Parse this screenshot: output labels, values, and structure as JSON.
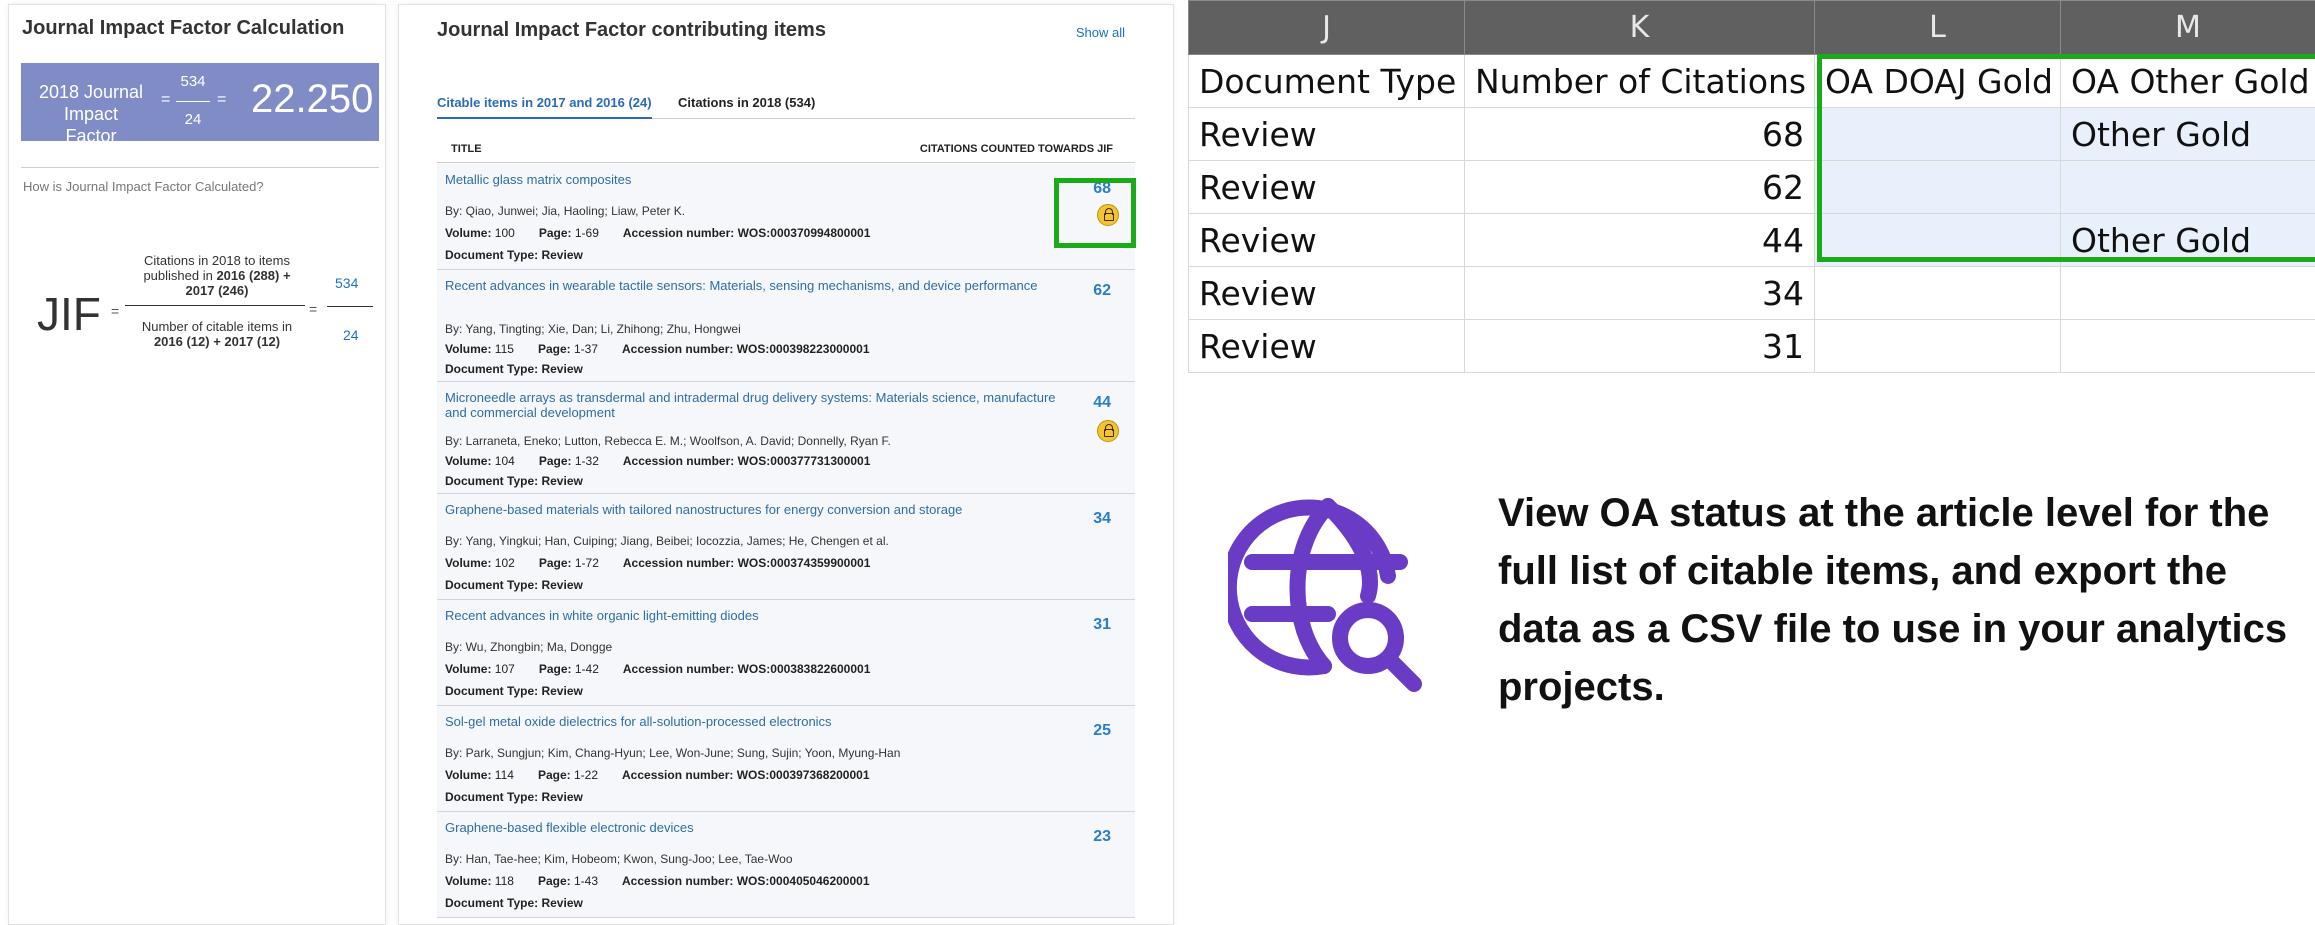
{
  "jif_panel": {
    "title": "Journal Impact Factor Calculation",
    "year_label": "2018 Journal Impact Factor",
    "numerator": "534",
    "denominator": "24",
    "value": "22.250",
    "how_link": "How is Journal Impact Factor Calculated?",
    "formula": {
      "symbol": "JIF",
      "numerator_text": "Citations in 2018 to items published in",
      "numerator_bold": "2016 (288) + 2017 (246)",
      "denominator_text": "Number of citable items in",
      "denominator_bold": "2016 (12) + 2017 (12)",
      "result_numerator": "534",
      "result_denominator": "24"
    }
  },
  "items_panel": {
    "title": "Journal Impact Factor contributing items",
    "show_all": "Show all",
    "tabs": [
      "Citable items in 2017 and 2016 (24)",
      "Citations in 2018 (534)"
    ],
    "col_title": "TITLE",
    "col_citations": "CITATIONS COUNTED TOWARDS JIF",
    "labels": {
      "volume": "Volume:",
      "page": "Page:",
      "accession": "Accession number:",
      "doc_type": "Document Type:"
    },
    "rows": [
      {
        "title": "Metallic glass matrix composites",
        "authors": "By: Qiao, Junwei; Jia, Haoling; Liaw, Peter K.",
        "volume": "100",
        "page": "1-69",
        "accession": "WOS:000370994800001",
        "doc_type": "Review",
        "citations": "68",
        "oa": true
      },
      {
        "title": "Recent advances in wearable tactile sensors: Materials, sensing mechanisms, and device performance",
        "authors": "By: Yang, Tingting; Xie, Dan; Li, Zhihong; Zhu, Hongwei",
        "volume": "115",
        "page": "1-37",
        "accession": "WOS:000398223000001",
        "doc_type": "Review",
        "citations": "62",
        "oa": false
      },
      {
        "title": "Microneedle arrays as transdermal and intradermal drug delivery systems: Materials science, manufacture and commercial development",
        "authors": "By: Larraneta, Eneko; Lutton, Rebecca E. M.; Woolfson, A. David; Donnelly, Ryan F.",
        "volume": "104",
        "page": "1-32",
        "accession": "WOS:000377731300001",
        "doc_type": "Review",
        "citations": "44",
        "oa": true
      },
      {
        "title": "Graphene-based materials with tailored nanostructures for energy conversion and storage",
        "authors": "By: Yang, Yingkui; Han, Cuiping; Jiang, Beibei; Iocozzia, James; He, Chengen et al.",
        "volume": "102",
        "page": "1-72",
        "accession": "WOS:000374359900001",
        "doc_type": "Review",
        "citations": "34",
        "oa": false
      },
      {
        "title": "Recent advances in white organic light-emitting diodes",
        "authors": "By: Wu, Zhongbin; Ma, Dongge",
        "volume": "107",
        "page": "1-42",
        "accession": "WOS:000383822600001",
        "doc_type": "Review",
        "citations": "31",
        "oa": false
      },
      {
        "title": "Sol-gel metal oxide dielectrics for all-solution-processed electronics",
        "authors": "By: Park, Sungjun; Kim, Chang-Hyun; Lee, Won-June; Sung, Sujin; Yoon, Myung-Han",
        "volume": "114",
        "page": "1-22",
        "accession": "WOS:000397368200001",
        "doc_type": "Review",
        "citations": "25",
        "oa": false
      },
      {
        "title": "Graphene-based flexible electronic devices",
        "authors": "By: Han, Tae-hee; Kim, Hobeom; Kwon, Sung-Joo; Lee, Tae-Woo",
        "volume": "118",
        "page": "1-43",
        "accession": "WOS:000405046200001",
        "doc_type": "Review",
        "citations": "23",
        "oa": false
      }
    ]
  },
  "spreadsheet": {
    "columns": [
      "J",
      "K",
      "L",
      "M"
    ],
    "headers": [
      "Document Type",
      "Number of Citations",
      "OA DOAJ Gold",
      "OA Other Gold"
    ],
    "rows": [
      [
        "Review",
        "68",
        "",
        "Other Gold"
      ],
      [
        "Review",
        "62",
        "",
        ""
      ],
      [
        "Review",
        "44",
        "",
        "Other Gold"
      ],
      [
        "Review",
        "34",
        "",
        ""
      ],
      [
        "Review",
        "31",
        "",
        ""
      ]
    ]
  },
  "promo": {
    "icon": "globe-search-icon",
    "icon_color": "#6a3bc4",
    "text": "View OA status at the article level for the full list of citable items, and export the data as a CSV file to use in your analytics projects."
  },
  "colors": {
    "highlight": "#1aaa1a",
    "jif_box": "#7f8cc6",
    "link": "#2e6da4",
    "oa_badge": "#f4c430"
  }
}
